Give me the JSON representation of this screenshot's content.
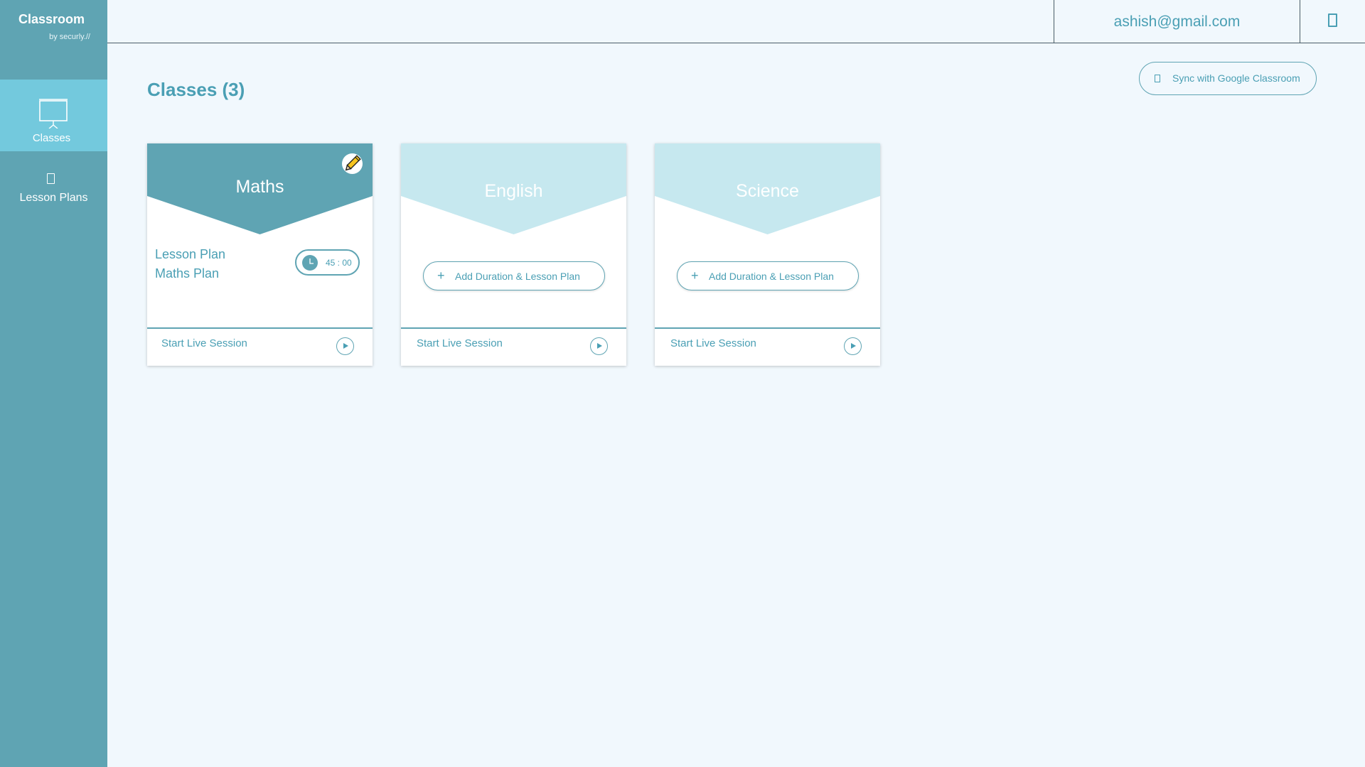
{
  "brand": {
    "title": "Classroom",
    "subtitle": "by securly.//"
  },
  "sidebar": {
    "items": [
      {
        "label": "Classes",
        "icon": "presentation-board-icon",
        "active": true
      },
      {
        "label": "Lesson Plans",
        "icon": "lesson-plan-icon",
        "active": false
      }
    ]
  },
  "header": {
    "user_email": "ashish@gmail.com",
    "icon": "logout-icon"
  },
  "main": {
    "title": "Classes (3)",
    "sync_button": {
      "label": "Sync with Google Classroom",
      "icon": "google-classroom-icon"
    }
  },
  "classes": [
    {
      "name": "Maths",
      "lesson_label": "Lesson Plan",
      "lesson_name": "Maths Plan",
      "duration": "45 : 00",
      "footer_label": "Start Live Session"
    },
    {
      "name": "English",
      "add_label": "Add Duration & Lesson Plan",
      "footer_label": "Start Live Session"
    },
    {
      "name": "Science",
      "add_label": "Add Duration & Lesson Plan",
      "footer_label": "Start Live Session"
    }
  ],
  "colors": {
    "sidebar": "#5fa4b3",
    "sidebar_active": "#73c9dd",
    "accent": "#4a9fb4",
    "card_active_header": "#5fa4b3",
    "card_idle_header": "#c6e8ef",
    "page_background": "#f1f8fd"
  }
}
